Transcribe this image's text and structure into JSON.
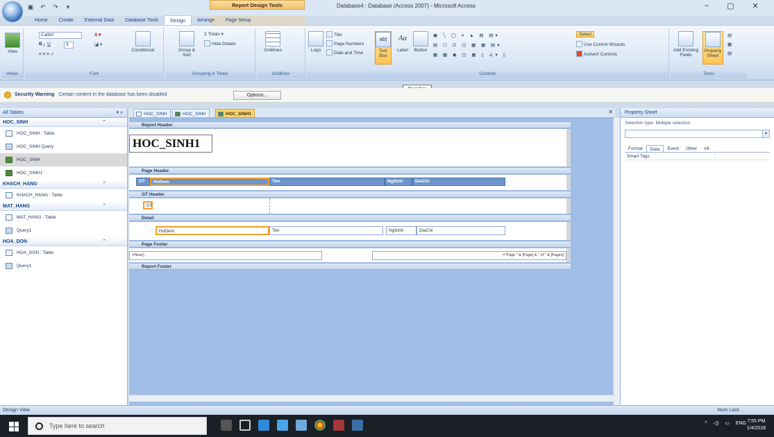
{
  "title_bar": {
    "context_tool_label": "Report Design Tools",
    "window_title": "Database4 : Database (Access 2007) - Microsoft Access",
    "minimize": "–",
    "maximize": "▢",
    "close": "✕"
  },
  "ribbon_tabs": [
    "Home",
    "Create",
    "External Data",
    "Database Tools",
    "Design",
    "Arrange",
    "Page Setup"
  ],
  "ribbon": {
    "views_label": "Views",
    "view_button": "View",
    "font_group": "Font",
    "font_name": "Calibri",
    "font_size": "9",
    "conditional": "Conditional",
    "grouping_group": "Grouping & Totals",
    "group_sort": "Group & Sort",
    "totals": "Σ Totals ▾",
    "hide_details": "Hide Details",
    "gridlines_group": "Gridlines",
    "gridlines": "Gridlines",
    "controls_group": "Controls",
    "logo": "Logo",
    "title": "Title",
    "page_numbers": "Page Numbers",
    "date_time": "Date and Time",
    "text_box": "Text Box",
    "label": "Label",
    "button": "Button",
    "select": "Select",
    "use_wizards": "Use Control Wizards",
    "activex": "ActiveX Controls",
    "tools_group": "Tools",
    "add_fields": "Add Existing Fields",
    "property_sheet": "Property Sheet"
  },
  "tooltip": "Text Box",
  "security": {
    "label": "Security Warning",
    "message": "Certain content in the database has been disabled",
    "options": "Options..."
  },
  "nav": {
    "header": "All Tables",
    "groups": [
      {
        "name": "HOC_SINH",
        "items": [
          {
            "label": "HOC_SINH : Table",
            "kind": "table"
          },
          {
            "label": "HOC_SINH Query",
            "kind": "query"
          },
          {
            "label": "HOC_SINH",
            "kind": "report",
            "selected": true
          },
          {
            "label": "HOC_SINH1",
            "kind": "report"
          }
        ]
      },
      {
        "name": "KHACH_HANG",
        "items": [
          {
            "label": "KHACH_HANG : Table",
            "kind": "table"
          }
        ]
      },
      {
        "name": "MAT_HANG",
        "items": [
          {
            "label": "MAT_HANG : Table",
            "kind": "table"
          },
          {
            "label": "Query1",
            "kind": "query"
          }
        ]
      },
      {
        "name": "HOA_DON",
        "items": [
          {
            "label": "HOA_DON : Table",
            "kind": "table"
          },
          {
            "label": "Query1",
            "kind": "query"
          }
        ]
      }
    ]
  },
  "doc_tabs": [
    "HOC_SINH",
    "HOC_SINH",
    "HOC_SINH1"
  ],
  "report": {
    "sections": {
      "report_header": "Report Header",
      "page_header": "Page Header",
      "gt_header": "GT Header",
      "detail": "Detail",
      "page_footer": "Page Footer",
      "report_footer": "Report Footer"
    },
    "title": "HOC_SINH1",
    "page_header_cells": [
      "GT",
      "HoDem",
      "Ten",
      "NgSinh",
      "DiaChi"
    ],
    "gt_cell": "GT",
    "detail_cells": [
      "HoDem",
      "Ten",
      "NgSinh",
      "DiaChi"
    ],
    "footer_now": "=Now()",
    "footer_pages": "=\"Page \" & [Page] & \" of \" & [Pages]"
  },
  "property_sheet": {
    "title": "Property Sheet",
    "selection": "Selection type: Multiple selection",
    "tabs": [
      "Format",
      "Data",
      "Event",
      "Other",
      "All"
    ],
    "active_tab": "Data",
    "rows": [
      "Smart Tags"
    ]
  },
  "status": {
    "left": "Design View",
    "right": "Num Lock"
  },
  "taskbar": {
    "search_placeholder": "Type here to search",
    "lang": "ENG",
    "time": "7:55 PM",
    "date": "1/4/2018"
  }
}
